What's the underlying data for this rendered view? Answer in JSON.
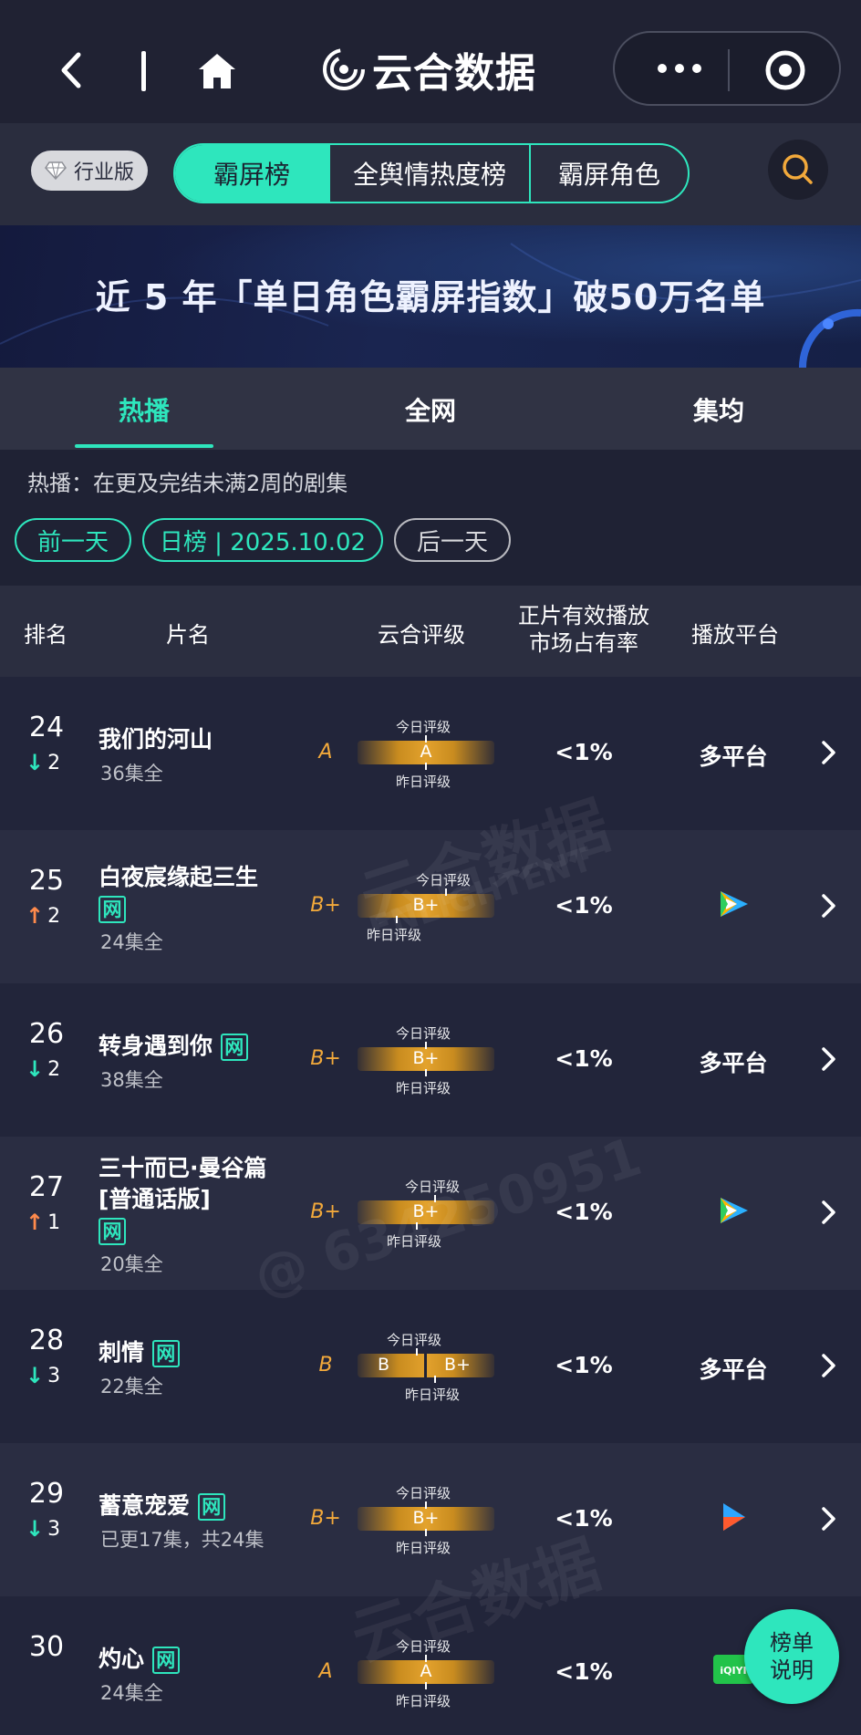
{
  "nav": {
    "brand": "云合数据"
  },
  "toolbar": {
    "industry_label": "行业版",
    "tabs": [
      {
        "label": "霸屏榜",
        "active": true
      },
      {
        "label": "全舆情热度榜",
        "active": false
      },
      {
        "label": "霸屏角色",
        "active": false
      }
    ]
  },
  "banner": {
    "text": "近 5 年「单日角色霸屏指数」破50万名单"
  },
  "subtabs": [
    {
      "label": "热播",
      "active": true
    },
    {
      "label": "全网",
      "active": false
    },
    {
      "label": "集均",
      "active": false
    }
  ],
  "description": "热播：在更及完结未满2周的剧集",
  "date_nav": {
    "prev": "前一天",
    "current": "日榜 | 2025.10.02",
    "next": "后一天"
  },
  "table": {
    "headers": {
      "rank": "排名",
      "title": "片名",
      "grade": "云合评级",
      "share_line1": "正片有效播放",
      "share_line2": "市场占有率",
      "platform": "播放平台"
    },
    "caption_today": "今日评级",
    "caption_yesterday": "昨日评级",
    "rows": [
      {
        "rank": "24",
        "change_dir": "down",
        "change": "2",
        "title_lines": [
          "我们的河山"
        ],
        "wang": false,
        "episodes": "36集全",
        "grade": "A",
        "bar_labels": [
          "A"
        ],
        "share": "<1%",
        "platform": "多平台",
        "platform_icon": ""
      },
      {
        "rank": "25",
        "change_dir": "up",
        "change": "2",
        "title_lines": [
          "白夜宸缘起三生"
        ],
        "wang": true,
        "episodes": "24集全",
        "grade": "B+",
        "bar_labels": [
          "B+"
        ],
        "share": "<1%",
        "platform": "",
        "platform_icon": "tencent-video"
      },
      {
        "rank": "26",
        "change_dir": "down",
        "change": "2",
        "title_lines": [
          "转身遇到你"
        ],
        "wang": true,
        "episodes": "38集全",
        "grade": "B+",
        "bar_labels": [
          "B+"
        ],
        "share": "<1%",
        "platform": "多平台",
        "platform_icon": ""
      },
      {
        "rank": "27",
        "change_dir": "up",
        "change": "1",
        "title_lines": [
          "三十而已·曼谷篇",
          "[普通话版]"
        ],
        "wang": true,
        "episodes": "20集全",
        "grade": "B+",
        "bar_labels": [
          "B+"
        ],
        "share": "<1%",
        "platform": "",
        "platform_icon": "tencent-video"
      },
      {
        "rank": "28",
        "change_dir": "down",
        "change": "3",
        "title_lines": [
          "刺情"
        ],
        "wang": true,
        "episodes": "22集全",
        "grade": "B",
        "bar_labels": [
          "B",
          "B+"
        ],
        "share": "<1%",
        "platform": "多平台",
        "platform_icon": ""
      },
      {
        "rank": "29",
        "change_dir": "down",
        "change": "3",
        "title_lines": [
          "蓄意宠爱"
        ],
        "wang": true,
        "episodes": "已更17集，共24集",
        "grade": "B+",
        "bar_labels": [
          "B+"
        ],
        "share": "<1%",
        "platform": "",
        "platform_icon": "youku"
      },
      {
        "rank": "30",
        "change_dir": "none",
        "change": "",
        "title_lines": [
          "灼心"
        ],
        "wang": true,
        "episodes": "24集全",
        "grade": "A",
        "bar_labels": [
          "A"
        ],
        "share": "<1%",
        "platform": "",
        "platform_icon": "iqiyi"
      }
    ],
    "wang_label": "网"
  },
  "float_button": {
    "line1": "榜单",
    "line2": "说明"
  },
  "watermarks": {
    "brand": "云合数据",
    "brand_en": "ENLIGHTENT",
    "user": "@ 634250951"
  },
  "colors": {
    "accent": "#2ee6bd",
    "grade": "#f2a93b",
    "up": "#ff8a4c",
    "down": "#2ee6bd",
    "bg": "#1f2234"
  }
}
